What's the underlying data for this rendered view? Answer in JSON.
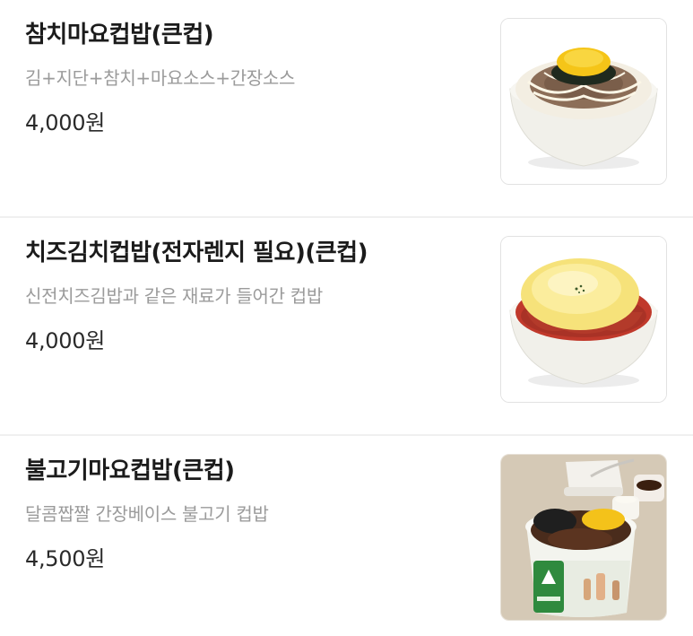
{
  "menu": {
    "items": [
      {
        "name": "참치마요컵밥(큰컵)",
        "description": "김+지단+참치+마요소스+간장소스",
        "price": "4,000원",
        "image_icon": "tuna-mayo-rice-bowl-icon"
      },
      {
        "name": "치즈김치컵밥(전자렌지 필요)(큰컵)",
        "description": "신전치즈김밥과 같은 재료가 들어간 컵밥",
        "price": "4,000원",
        "image_icon": "cheese-kimchi-rice-bowl-icon"
      },
      {
        "name": "불고기마요컵밥(큰컵)",
        "description": "달콤짭짤 간장베이스 불고기 컵밥",
        "price": "4,500원",
        "image_icon": "bulgogi-mayo-rice-cup-icon"
      }
    ]
  }
}
